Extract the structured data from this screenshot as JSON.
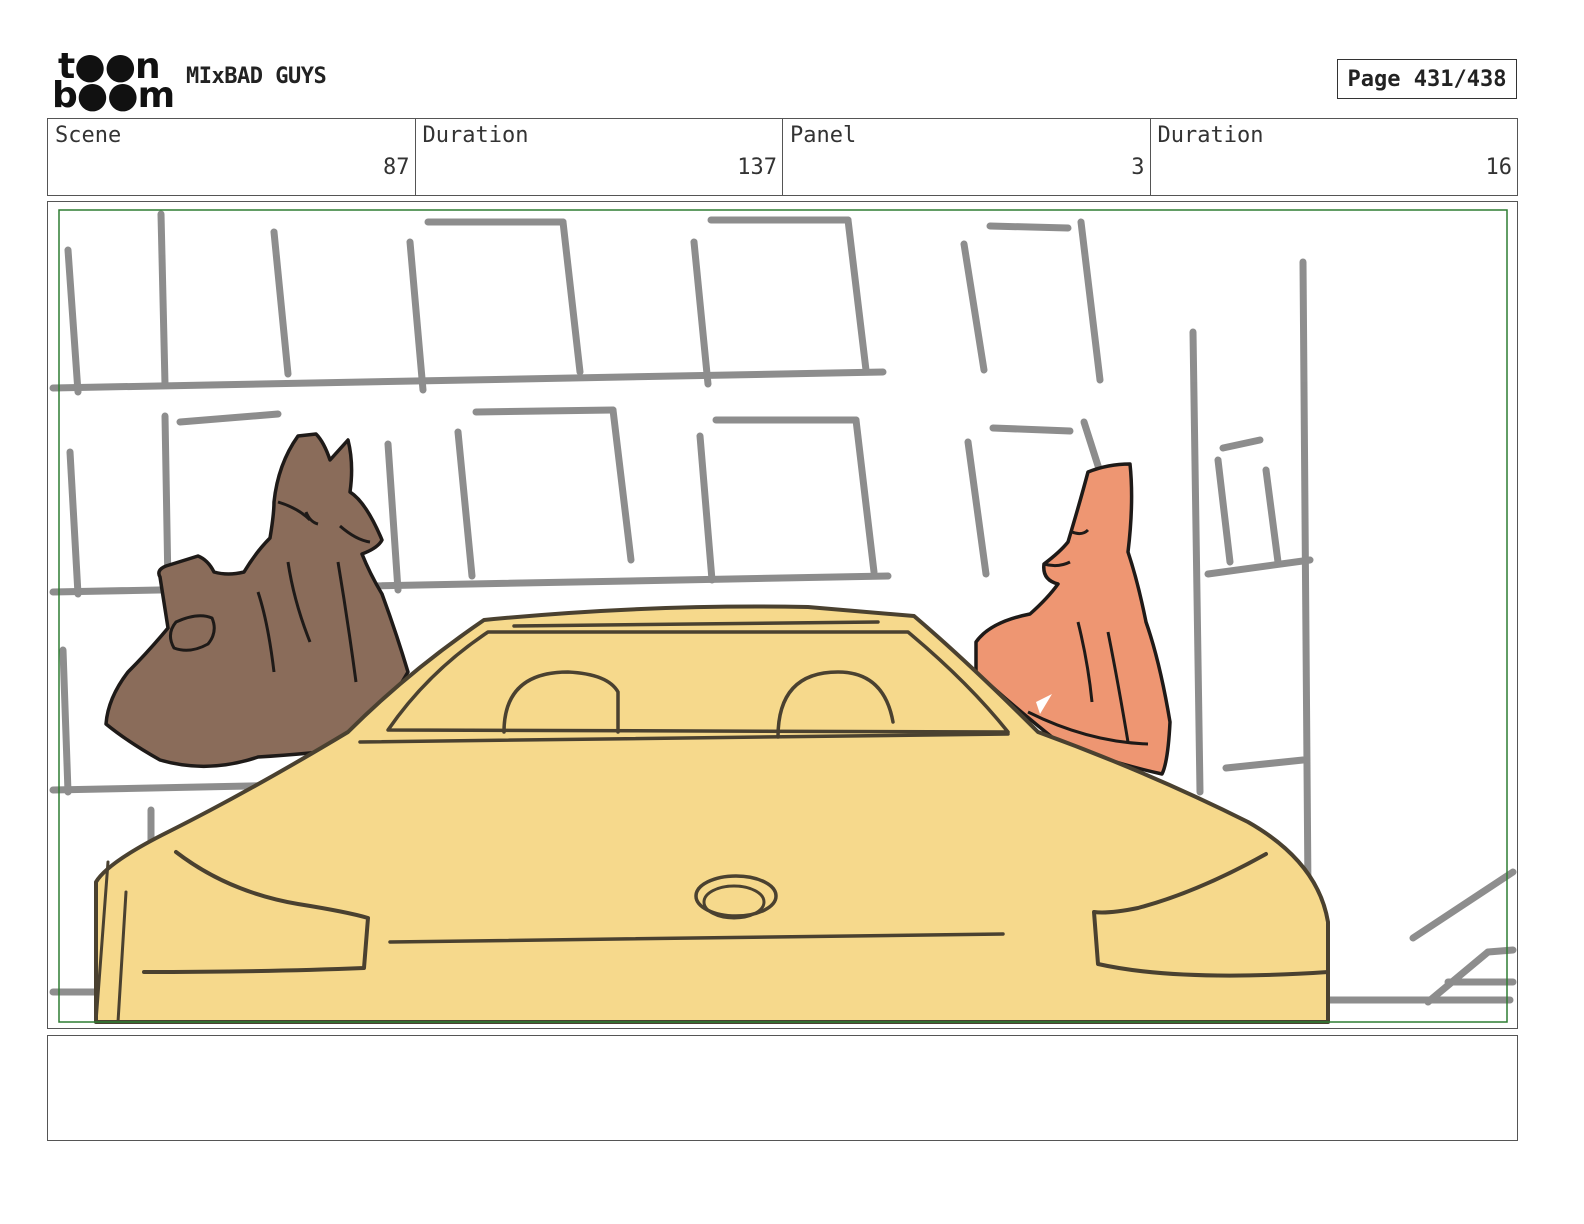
{
  "header": {
    "logo_line1": "t●●n",
    "logo_line2": "b●●m",
    "project_title": "MIxBAD GUYS",
    "page_label": "Page 431/438"
  },
  "info": {
    "scene_label": "Scene",
    "scene_value": "87",
    "scene_duration_label": "Duration",
    "scene_duration_value": "137",
    "panel_label": "Panel",
    "panel_value": "3",
    "panel_duration_label": "Duration",
    "panel_duration_value": "16"
  },
  "panel_image": {
    "subject": "storyboard-sketch",
    "colors": {
      "car": "#f6d98c",
      "wolf": "#8a6c5a",
      "fox": "#ee9672",
      "frame_border": "#2e7d32",
      "background_lines": "#777777"
    }
  },
  "notes": {
    "text": ""
  }
}
